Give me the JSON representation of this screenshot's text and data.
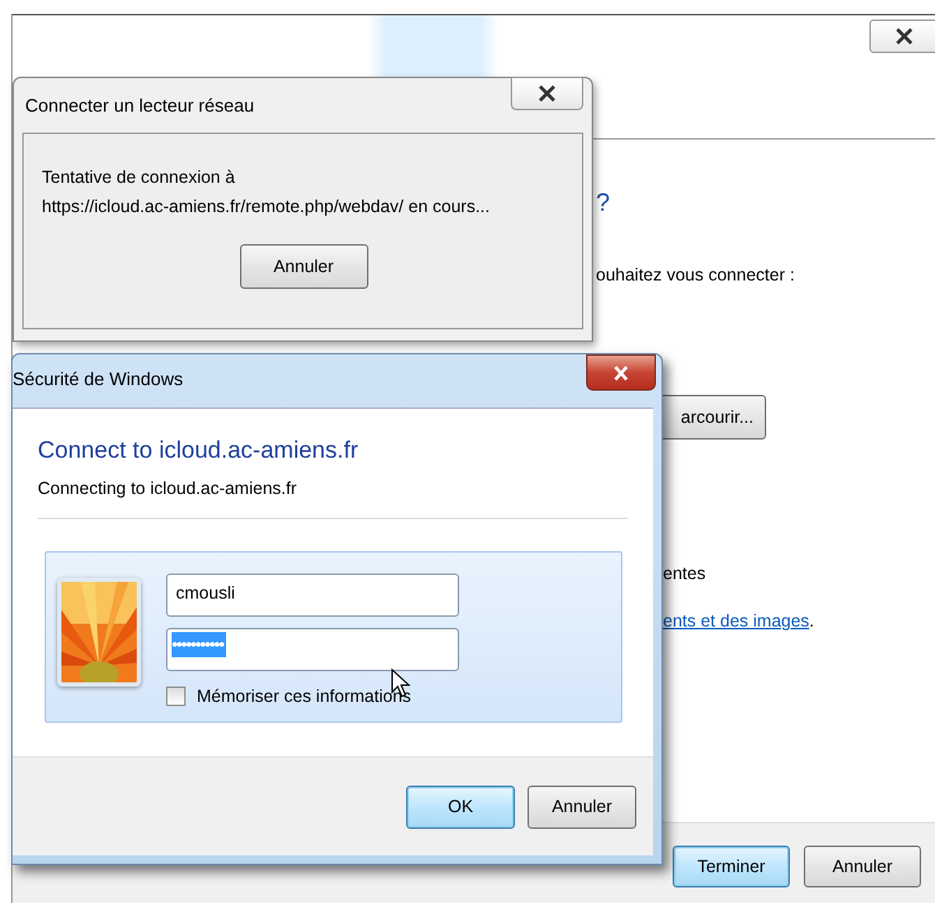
{
  "background_window": {
    "question_mark": "?",
    "prompt": "ouhaitez vous connecter :",
    "browse_button": "arcourir...",
    "option_label": "entes",
    "link": "ents et des images",
    "link_suffix": ".",
    "buttons": [
      {
        "label": "Terminer",
        "default": true
      },
      {
        "label": "Annuler",
        "default": false
      }
    ]
  },
  "progress_dialog": {
    "title": "Connecter un lecteur réseau",
    "message_lines": [
      "Tentative de connexion à",
      "https://icloud.ac-amiens.fr/remote.php/webdav/ en cours..."
    ],
    "cancel_button": "Annuler"
  },
  "security_dialog": {
    "title": "Sécurité de Windows",
    "heading": "Connect to icloud.ac-amiens.fr",
    "subheading": "Connecting to icloud.ac-amiens.fr",
    "username": "cmousli",
    "password": {
      "value": "•••••••••••",
      "selected": true
    },
    "remember": {
      "label": "Mémoriser ces informations",
      "checked": false
    },
    "buttons": [
      {
        "label": "OK",
        "default": true
      },
      {
        "label": "Annuler",
        "default": false
      }
    ]
  }
}
